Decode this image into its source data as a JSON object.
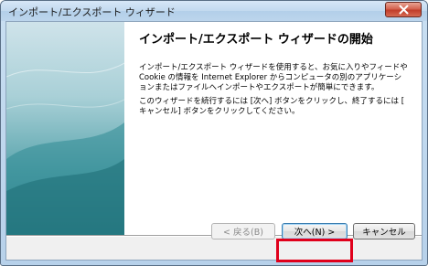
{
  "window": {
    "title": "インポート/エクスポート ウィザード",
    "close_icon": "close-icon"
  },
  "main": {
    "heading": "インポート/エクスポート ウィザードの開始",
    "paragraph1": "インポート/エクスポート ウィザードを使用すると、お気に入りやフィードや\nCookie の情報を Internet Explorer からコンピュータの別のアプリケーシ\nョンまたはファイルへインポートやエクスポートが簡単にできます。",
    "paragraph2": "このウィザードを続行するには [次へ] ボタンをクリックし、終了するには [\nキャンセル] ボタンをクリックしてください。"
  },
  "buttons": {
    "back_label": "< 戻る(B)",
    "next_label": "次へ(N) >",
    "cancel_label": "キャンセル"
  },
  "colors": {
    "highlight": "#e0001b",
    "sidebar_bottom": "#2b7c86",
    "close_button": "#c13e2a"
  }
}
